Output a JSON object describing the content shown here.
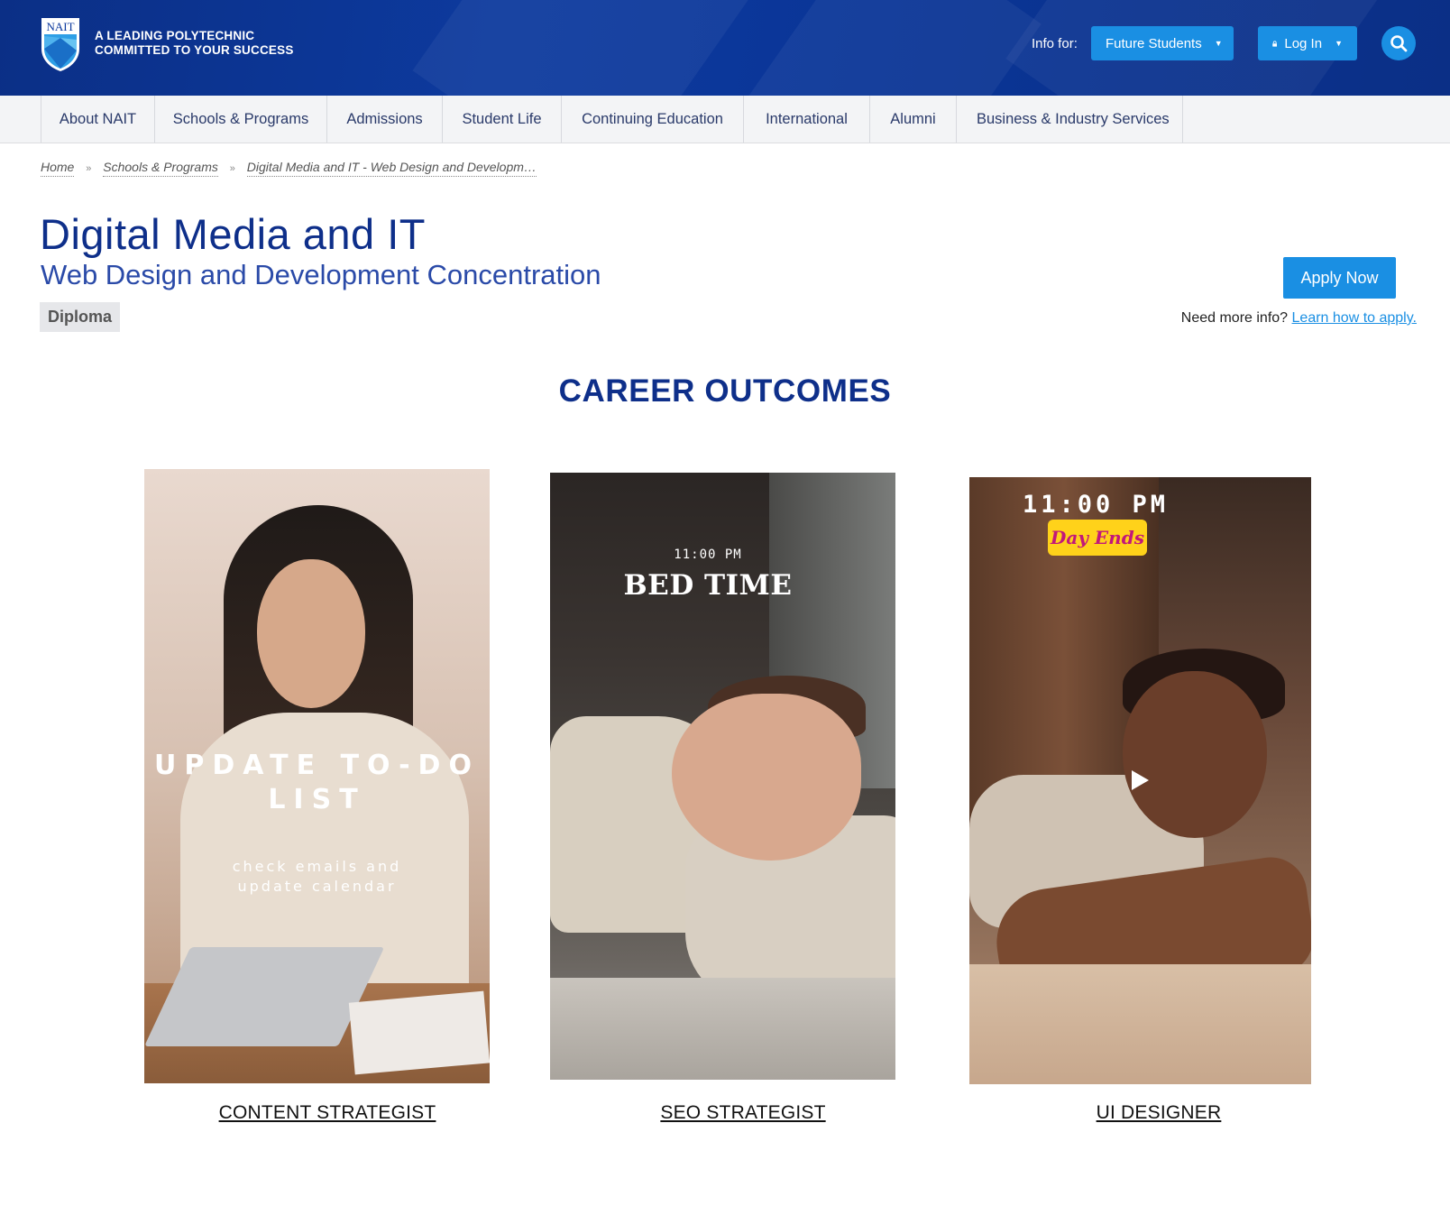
{
  "header": {
    "logo_text": "NAIT",
    "tagline_line1": "A LEADING POLYTECHNIC",
    "tagline_line2": "COMMITTED TO YOUR SUCCESS",
    "info_for_label": "Info for:",
    "info_for_value": "Future Students",
    "login_label": "Log In",
    "icons": {
      "search": "search-icon",
      "lock": "lock-icon",
      "caret": "caret-down-icon"
    }
  },
  "nav": {
    "items": [
      {
        "label": "About NAIT"
      },
      {
        "label": "Schools & Programs"
      },
      {
        "label": "Admissions"
      },
      {
        "label": "Student Life"
      },
      {
        "label": "Continuing Education"
      },
      {
        "label": "International"
      },
      {
        "label": "Alumni"
      },
      {
        "label": "Business & Industry Services"
      }
    ]
  },
  "breadcrumb": {
    "items": [
      {
        "label": "Home"
      },
      {
        "label": "Schools & Programs"
      },
      {
        "label": "Digital Media and IT - Web Design and Developm…"
      }
    ],
    "separator": "»"
  },
  "program": {
    "title": "Digital Media and IT",
    "subtitle": "Web Design and Development Concentration",
    "credential": "Diploma",
    "apply_label": "Apply Now",
    "more_info_text": "Need more info?",
    "more_info_link": "Learn how to apply."
  },
  "career": {
    "section_title": "CAREER OUTCOMES",
    "cards": [
      {
        "caption": "CONTENT STRATEGIST",
        "overlay_title": "UPDATE TO-DO LIST",
        "overlay_line1": "check emails and",
        "overlay_line2": "update calendar"
      },
      {
        "caption": "SEO STRATEGIST",
        "overlay_time": "11:00 PM",
        "overlay_title": "BED TIME"
      },
      {
        "caption": "UI DESIGNER",
        "overlay_time": "11:00 PM",
        "overlay_tag": "Day Ends",
        "play_icon": "play-icon"
      }
    ]
  },
  "colors": {
    "header_blue": "#0d3a9e",
    "accent_blue": "#1a8fe3",
    "title_blue": "#0e2f8a",
    "tag_yellow": "#ffd21a"
  }
}
